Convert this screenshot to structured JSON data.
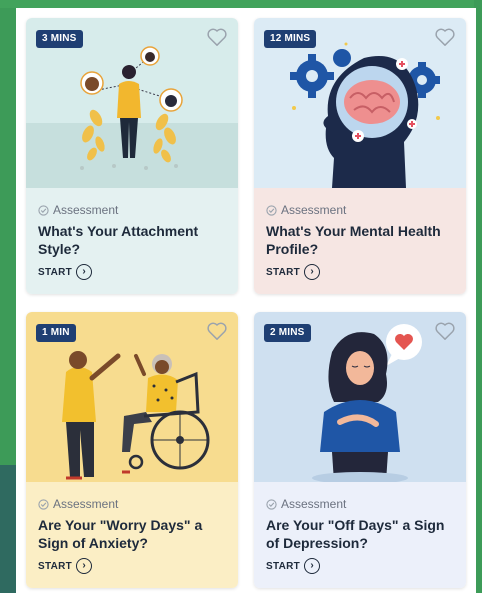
{
  "colors": {
    "badge_bg": "#1f3f73",
    "title_text": "#1e2a3b",
    "meta_text": "#6b7280",
    "page_bg": "#3d9b58"
  },
  "cards": [
    {
      "duration": "3 MINS",
      "kind": "Assessment",
      "title": "What's Your Attachment Style?",
      "cta": "START",
      "icon": "heart-outline-icon",
      "illustration": "people-connected-illustration"
    },
    {
      "duration": "12 MINS",
      "kind": "Assessment",
      "title": "What's Your Mental Health Profile?",
      "cta": "START",
      "icon": "heart-outline-icon",
      "illustration": "head-with-brain-illustration"
    },
    {
      "duration": "1 MIN",
      "kind": "Assessment",
      "title": "Are Your \"Worry Days\" a Sign of Anxiety?",
      "cta": "START",
      "icon": "heart-outline-icon",
      "illustration": "caregiver-wheelchair-illustration"
    },
    {
      "duration": "2 MINS",
      "kind": "Assessment",
      "title": "Are Your \"Off Days\" a Sign of Depression?",
      "cta": "START",
      "icon": "heart-outline-icon",
      "illustration": "woman-hand-on-heart-illustration"
    }
  ]
}
